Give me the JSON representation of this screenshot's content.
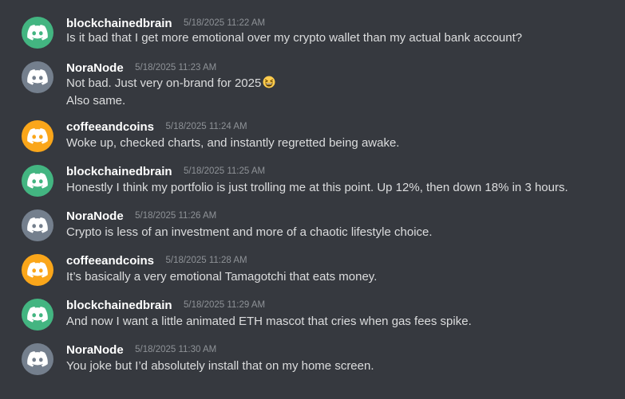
{
  "messages": [
    {
      "username": "blockchainedbrain",
      "timestamp": "5/18/2025 11:22 AM",
      "avatar_color": "#43b581",
      "lines": [
        "Is it bad that I get more emotional over my crypto wallet than my actual bank account?"
      ]
    },
    {
      "username": "NoraNode",
      "timestamp": "5/18/2025 11:23 AM",
      "avatar_color": "#747f8d",
      "lines": [
        "Not bad. Just very on-brand for 2025",
        "Also same."
      ],
      "emoji": "grinning-squinting-face"
    },
    {
      "username": "coffeeandcoins",
      "timestamp": "5/18/2025 11:24 AM",
      "avatar_color": "#faa61a",
      "lines": [
        "Woke up, checked charts, and instantly regretted being awake."
      ]
    },
    {
      "username": "blockchainedbrain",
      "timestamp": "5/18/2025 11:25 AM",
      "avatar_color": "#43b581",
      "lines": [
        "Honestly I think my portfolio is just trolling me at this point. Up 12%, then down 18% in 3 hours."
      ]
    },
    {
      "username": "NoraNode",
      "timestamp": "5/18/2025 11:26 AM",
      "avatar_color": "#747f8d",
      "lines": [
        "Crypto is less of an investment and more of a chaotic lifestyle choice."
      ]
    },
    {
      "username": "coffeeandcoins",
      "timestamp": "5/18/2025 11:28 AM",
      "avatar_color": "#faa61a",
      "lines": [
        "It’s basically a very emotional Tamagotchi that eats money."
      ]
    },
    {
      "username": "blockchainedbrain",
      "timestamp": "5/18/2025 11:29 AM",
      "avatar_color": "#43b581",
      "lines": [
        "And now I want a little animated ETH mascot that cries when gas fees spike."
      ]
    },
    {
      "username": "NoraNode",
      "timestamp": "5/18/2025 11:30 AM",
      "avatar_color": "#747f8d",
      "lines": [
        "You joke but I’d absolutely install that on my home screen."
      ]
    }
  ]
}
